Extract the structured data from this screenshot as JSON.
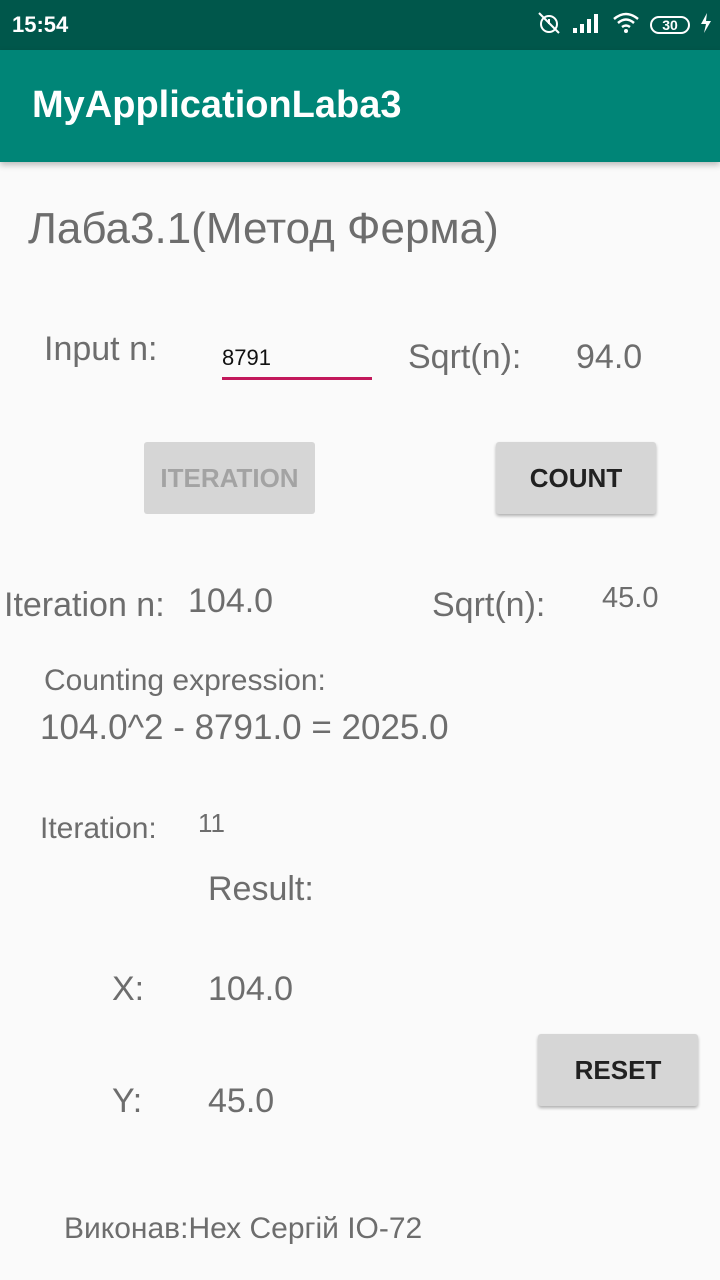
{
  "status": {
    "time": "15:54",
    "battery": "30"
  },
  "app": {
    "title": "MyApplicationLaba3"
  },
  "main": {
    "heading": "Лаба3.1(Метод Ферма)",
    "input_label": "Input n:",
    "input_value": "8791",
    "sqrt_label": "Sqrt(n):",
    "sqrt_value": "94.0",
    "iteration_button": "ITERATION",
    "count_button": "COUNT",
    "iteration_n_label": "Iteration n:",
    "iteration_n_value": "104.0",
    "sqrt2_label": "Sqrt(n):",
    "sqrt2_value": "45.0",
    "counting_label": "Counting expression:",
    "counting_expression": "104.0^2 - 8791.0 = 2025.0",
    "iteration_label": "Iteration:",
    "iteration_value": "11",
    "result_label": "Result:",
    "x_label": "X:",
    "x_value": "104.0",
    "y_label": "Y:",
    "y_value": "45.0",
    "reset_button": "RESET",
    "footer": "Виконав:Нех Сергій ІО-72"
  },
  "colors": {
    "statusbar": "#00574b",
    "appbar": "#008577",
    "accent": "#c2185b"
  },
  "icons": [
    "muted-alarm-icon",
    "signal-icon",
    "wifi-icon",
    "battery-icon",
    "charging-icon"
  ]
}
